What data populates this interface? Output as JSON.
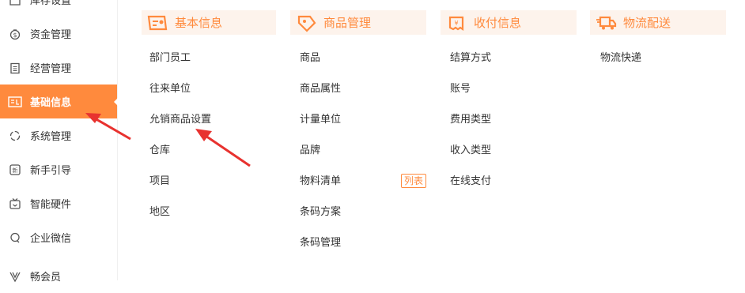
{
  "sidebar": {
    "items": [
      {
        "label": "库存设置",
        "icon": "warehouse-icon"
      },
      {
        "label": "资金管理",
        "icon": "money-bag-icon"
      },
      {
        "label": "经营管理",
        "icon": "clipboard-icon"
      },
      {
        "label": "基础信息",
        "icon": "id-card-icon",
        "active": true
      },
      {
        "label": "系统管理",
        "icon": "loop-icon"
      },
      {
        "label": "新手引导",
        "icon": "newbie-badge-icon"
      },
      {
        "label": "智能硬件",
        "icon": "tv-icon"
      },
      {
        "label": "企业微信",
        "icon": "chat-bubble-icon"
      },
      {
        "label": "畅会员",
        "icon": "v-badge-icon"
      }
    ]
  },
  "columns": [
    {
      "title": "基本信息",
      "icon": "id-card-icon",
      "links": [
        "部门员工",
        "往来单位",
        "允销商品设置",
        "仓库",
        "项目",
        "地区"
      ]
    },
    {
      "title": "商品管理",
      "icon": "price-tag-icon",
      "links": [
        "商品",
        "商品属性",
        "计量单位",
        "品牌",
        "物料清单",
        "条码方案",
        "条码管理"
      ],
      "tag": {
        "after_index": 4,
        "label": "列表"
      }
    },
    {
      "title": "收付信息",
      "icon": "receipt-icon",
      "links": [
        "结算方式",
        "账号",
        "费用类型",
        "收入类型",
        "在线支付"
      ]
    },
    {
      "title": "物流配送",
      "icon": "delivery-truck-icon",
      "links": [
        "物流快递"
      ]
    }
  ],
  "colors": {
    "accent": "#ff8a3d",
    "header_bg": "#fdf3ec",
    "annotation_arrow": "#e8322f"
  }
}
